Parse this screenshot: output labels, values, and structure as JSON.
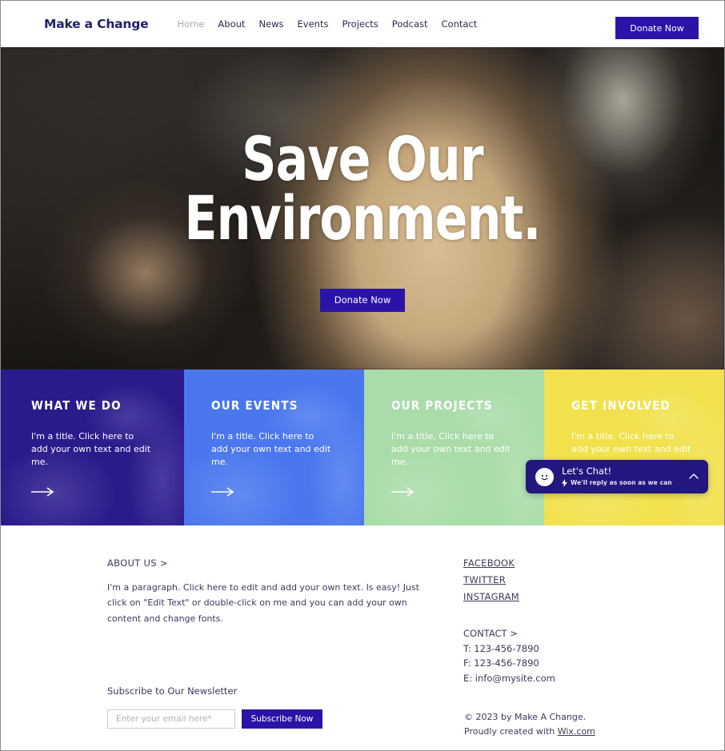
{
  "header": {
    "brand": "Make a Change",
    "nav": [
      {
        "label": "Home",
        "active": true
      },
      {
        "label": "About",
        "active": false
      },
      {
        "label": "News",
        "active": false
      },
      {
        "label": "Events",
        "active": false
      },
      {
        "label": "Projects",
        "active": false
      },
      {
        "label": "Podcast",
        "active": false
      },
      {
        "label": "Contact",
        "active": false
      }
    ],
    "donate_label": "Donate Now"
  },
  "hero": {
    "title_line1": "Save Our",
    "title_line2": "Environment.",
    "cta_label": "Donate Now"
  },
  "panels": [
    {
      "title": "WHAT WE DO",
      "text": "I'm a title. Click here to add your own text and edit me.",
      "color": "#2a1b8c",
      "arrow": "arrow-right-icon"
    },
    {
      "title": "OUR EVENTS",
      "text": "I'm a title. Click here to add your own text and edit me.",
      "color": "#4a77ee",
      "arrow": "arrow-right-icon"
    },
    {
      "title": "OUR PROJECTS",
      "text": "I'm a title. Click here to add your own text and edit me.",
      "color": "#a9dca9",
      "arrow": "arrow-right-icon"
    },
    {
      "title": "GET INVOLVED",
      "text": "I'm a title. Click here to add your own text and edit me.",
      "color": "#f2e14c",
      "arrow": "arrow-right-icon"
    }
  ],
  "chat": {
    "title": "Let's Chat!",
    "subtitle": "We'll reply as soon as we can",
    "avatar_icon": "smiley-face-icon",
    "bolt_icon": "lightning-bolt-icon",
    "toggle_icon": "chevron-up-icon"
  },
  "footer": {
    "about_heading": "ABOUT US >",
    "about_paragraph": "I'm a paragraph. Click here to edit and add your own text. Is easy! Just click on \"Edit Text\" or double-click on me and you can add your own content and change fonts.",
    "social_links": [
      "FACEBOOK",
      "TWITTER",
      "INSTAGRAM"
    ],
    "contact_heading": "CONTACT >",
    "contact_lines": [
      "T: 123-456-7890",
      "F: 123-456-7890",
      "E: info@mysite.com"
    ],
    "newsletter_label": "Subscribe to Our Newsletter",
    "email_placeholder": "Enter your email here*",
    "email_value": "",
    "subscribe_label": "Subscribe Now",
    "copyright": "© 2023 by Make A Change.",
    "credit_prefix": "Proudly created with ",
    "credit_link": "Wix.com"
  },
  "colors": {
    "brand_navy": "#21216b",
    "accent_indigo": "#2a14a8",
    "panel_1": "#2a1b8c",
    "panel_2": "#4a77ee",
    "panel_3": "#a9dca9",
    "panel_4": "#f2e14c",
    "chat_bg": "#22177e",
    "text_muted": "#3a3a5c"
  }
}
